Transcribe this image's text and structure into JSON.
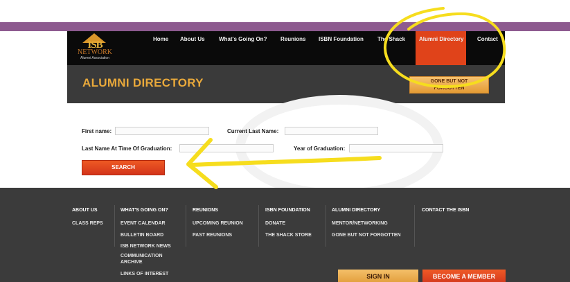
{
  "logo": {
    "mark": "ISB",
    "word": "NETWORK",
    "sub": "Alumni Association"
  },
  "nav": {
    "items": [
      "Home",
      "About Us",
      "What's Going On?",
      "Reunions",
      "ISBN Foundation",
      "The Shack",
      "Alumni Directory",
      "Contact"
    ],
    "active": "Alumni Directory"
  },
  "hero": {
    "title": "ALUMNI DIRECTORY",
    "gbnf_line1": "GONE BUT NOT",
    "gbnf_line2": "FORGOTTEN"
  },
  "form": {
    "first_name_label": "First name:",
    "current_last_label": "Current Last Name:",
    "grad_last_label": "Last Name At Time Of Graduation:",
    "year_label": "Year of Graduation:",
    "search_label": "SEARCH"
  },
  "footer": {
    "about": {
      "title": "ABOUT US",
      "links": [
        "CLASS REPS"
      ]
    },
    "whats_on": {
      "title": "WHAT'S GOING ON?",
      "links": [
        "EVENT CALENDAR",
        "BULLETIN BOARD",
        "ISB NETWORK NEWS",
        "COMMUNICATION",
        "ARCHIVE",
        "LINKS OF INTEREST"
      ]
    },
    "reunions": {
      "title": "REUNIONS",
      "links": [
        "UPCOMING REUNION",
        "PAST REUNIONS"
      ]
    },
    "foundation": {
      "title": "ISBN FOUNDATION",
      "links": [
        "DONATE",
        "THE SHACK STORE"
      ]
    },
    "directory": {
      "title": "ALUMNI DIRECTORY",
      "links": [
        "MENTOR/NETWORKING",
        "GONE BUT NOT FORGOTTEN"
      ]
    },
    "contact": {
      "title": "CONTACT THE ISBN"
    },
    "sign_in": "SIGN IN",
    "become_member": "BECOME A MEMBER"
  },
  "colors": {
    "accent_orange": "#e0431a",
    "title_gold": "#e9a93b",
    "annotation_yellow": "#f6dd1e",
    "header_purple": "#8d5a8f"
  }
}
